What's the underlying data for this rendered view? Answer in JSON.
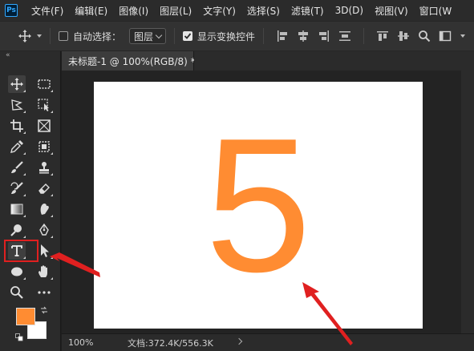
{
  "menubar": {
    "logo": "Ps",
    "items": [
      "文件(F)",
      "编辑(E)",
      "图像(I)",
      "图层(L)",
      "文字(Y)",
      "选择(S)",
      "滤镜(T)",
      "3D(D)",
      "视图(V)",
      "窗口(W"
    ]
  },
  "options": {
    "auto_select_label": "自动选择：",
    "auto_select_checked": false,
    "target_value": "图层",
    "transform_controls_label": "显示变换控件",
    "transform_controls_checked": true
  },
  "toolbar": {
    "collapse_label": "«",
    "foreground_color": "#ff8c32",
    "background_color": "#ffffff",
    "selected_tool": "type-tool"
  },
  "document": {
    "tab_title": "未标题-1 @ 100%(RGB/8) *",
    "canvas_text": "5",
    "text_color": "#ff8c32"
  },
  "status": {
    "zoom": "100%",
    "doc_info": "文档:372.4K/556.3K"
  },
  "annotation_color": "#e02020"
}
